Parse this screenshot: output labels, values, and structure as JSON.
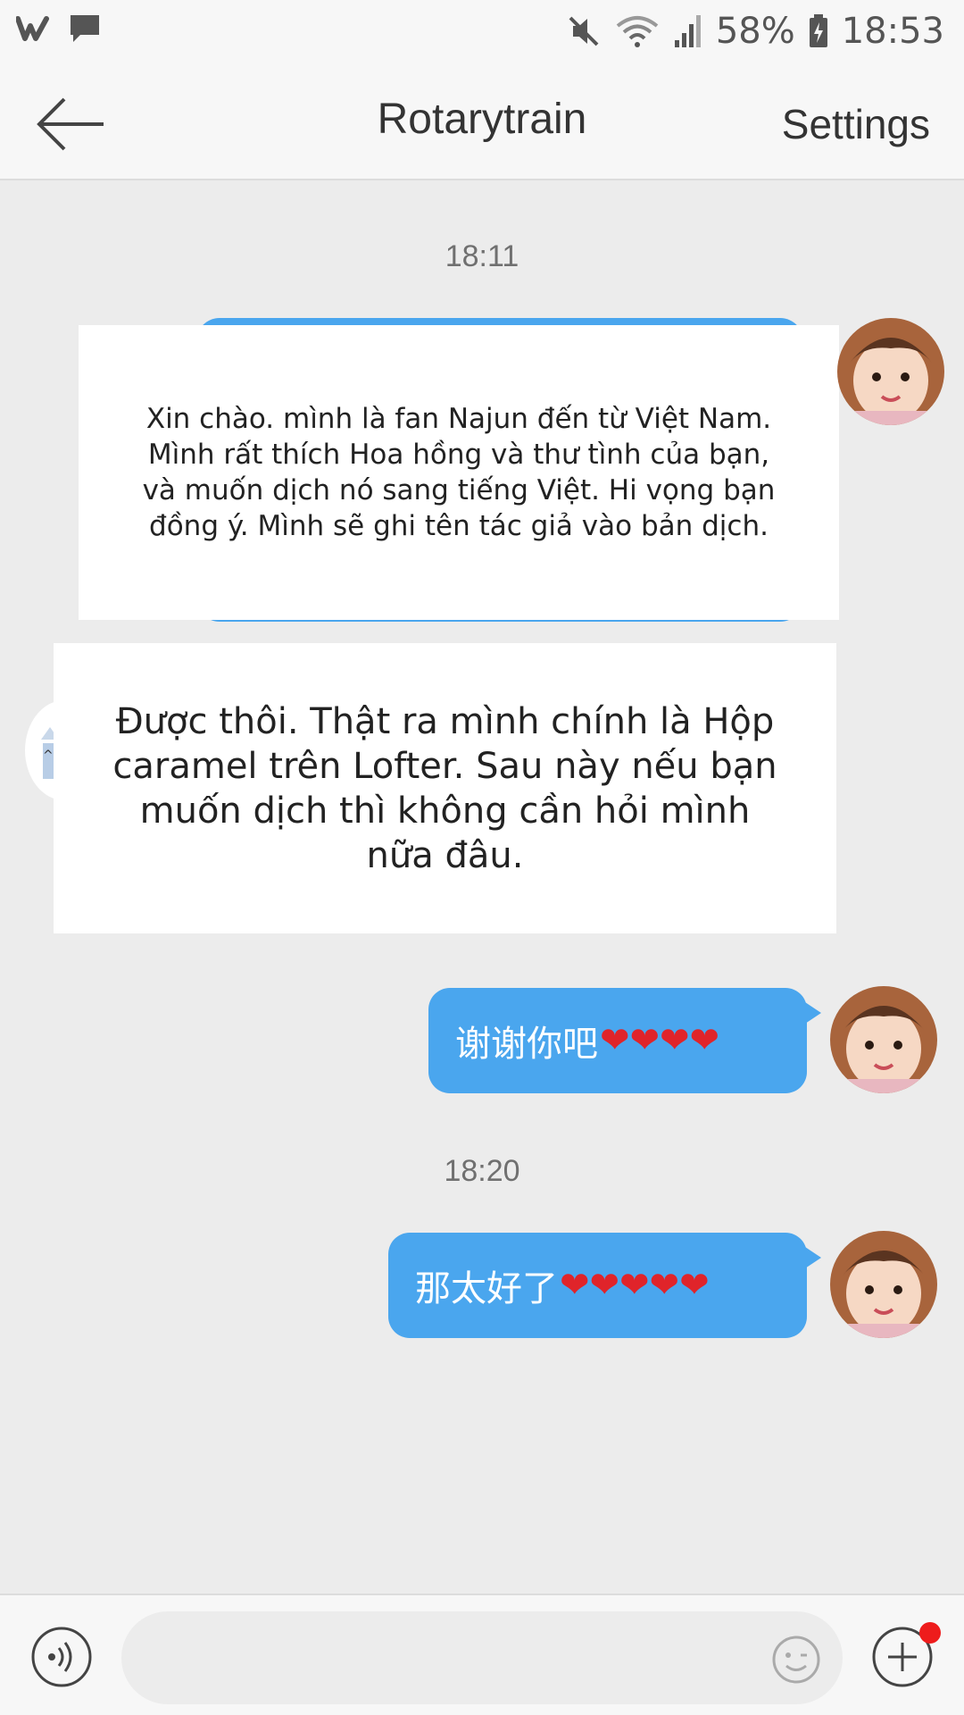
{
  "status_bar": {
    "battery": "58%",
    "time": "18:53",
    "icons": [
      "wattpad-icon",
      "message-icon",
      "mute-icon",
      "wifi-icon",
      "signal-icon",
      "battery-icon"
    ]
  },
  "header": {
    "title": "Rotarytrain",
    "settings_label": "Settings"
  },
  "messages": {
    "timestamp1": "18:11",
    "msg1_text": "Xin chào. mình là fan Najun đến từ Việt Nam. Mình rất thích Hoa hồng và thư tình của bạn, và muốn dịch nó sang tiếng Việt. Hi vọng bạn đồng ý. Mình sẽ ghi tên tác giả vào bản dịch.",
    "msg2_text": "Được thôi. Thật ra mình chính là Hộp caramel trên Lofter. Sau này nếu bạn muốn dịch thì không cần hỏi mình nữa đâu.",
    "msg3_text": "谢谢你吧",
    "msg3_hearts": "❤❤❤❤",
    "timestamp2": "18:20",
    "msg4_text": "那太好了",
    "msg4_hearts": "❤❤❤❤❤"
  },
  "input": {
    "placeholder": ""
  },
  "colors": {
    "bubble_blue": "#4aa6ee",
    "background": "#ececec",
    "bar": "#f7f7f7",
    "heart": "#e0242a",
    "notification_dot": "#ee1c1c"
  }
}
